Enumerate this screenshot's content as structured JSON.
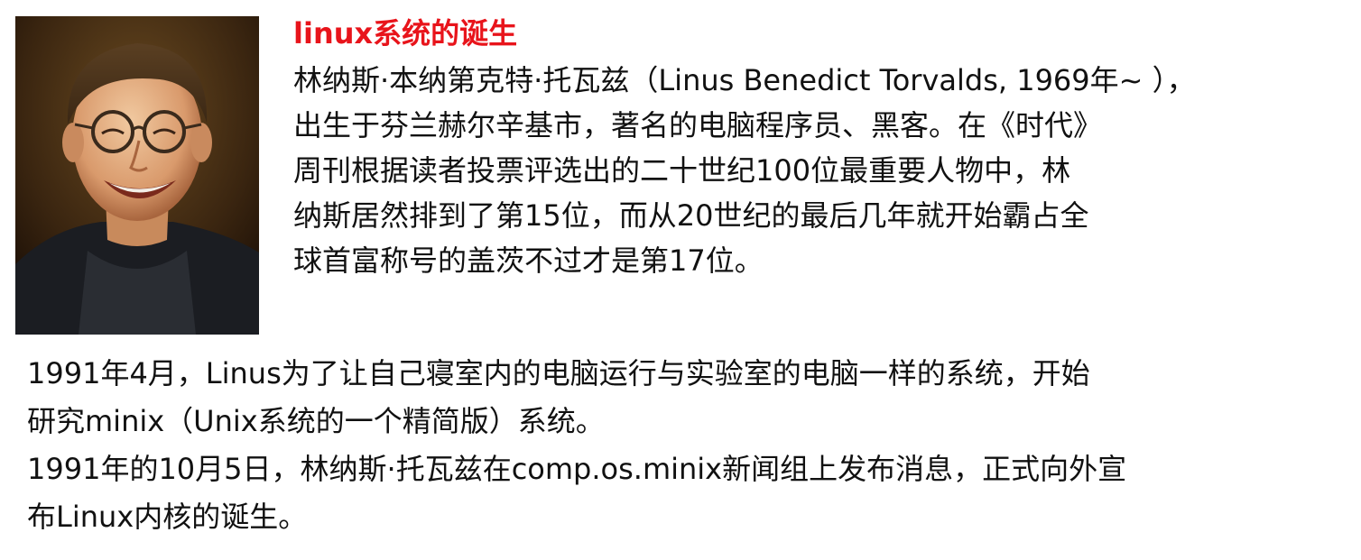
{
  "photo": {
    "alt": "Linus Torvalds portrait"
  },
  "article": {
    "title": "linux系统的诞生",
    "bio_lines": [
      "林纳斯·本纳第克特·托瓦兹（Linus Benedict Torvalds, 1969年~ ），",
      "出生于芬兰赫尔辛基市，著名的电脑程序员、黑客。在《时代》",
      "周刊根据读者投票评选出的二十世纪100位最重要人物中，林",
      "纳斯居然排到了第15位，而从20世纪的最后几年就开始霸占全",
      "球首富称号的盖茨不过才是第17位。"
    ],
    "history_lines": [
      "1991年4月，Linus为了让自己寝室内的电脑运行与实验室的电脑一样的系统，开始",
      "研究minix（Unix系统的一个精简版）系统。",
      "1991年的10月5日，林纳斯·托瓦兹在comp.os.minix新闻组上发布消息，正式向外宣",
      "布Linux内核的诞生。"
    ]
  },
  "colors": {
    "title": "#e8141b",
    "text": "#111111"
  }
}
